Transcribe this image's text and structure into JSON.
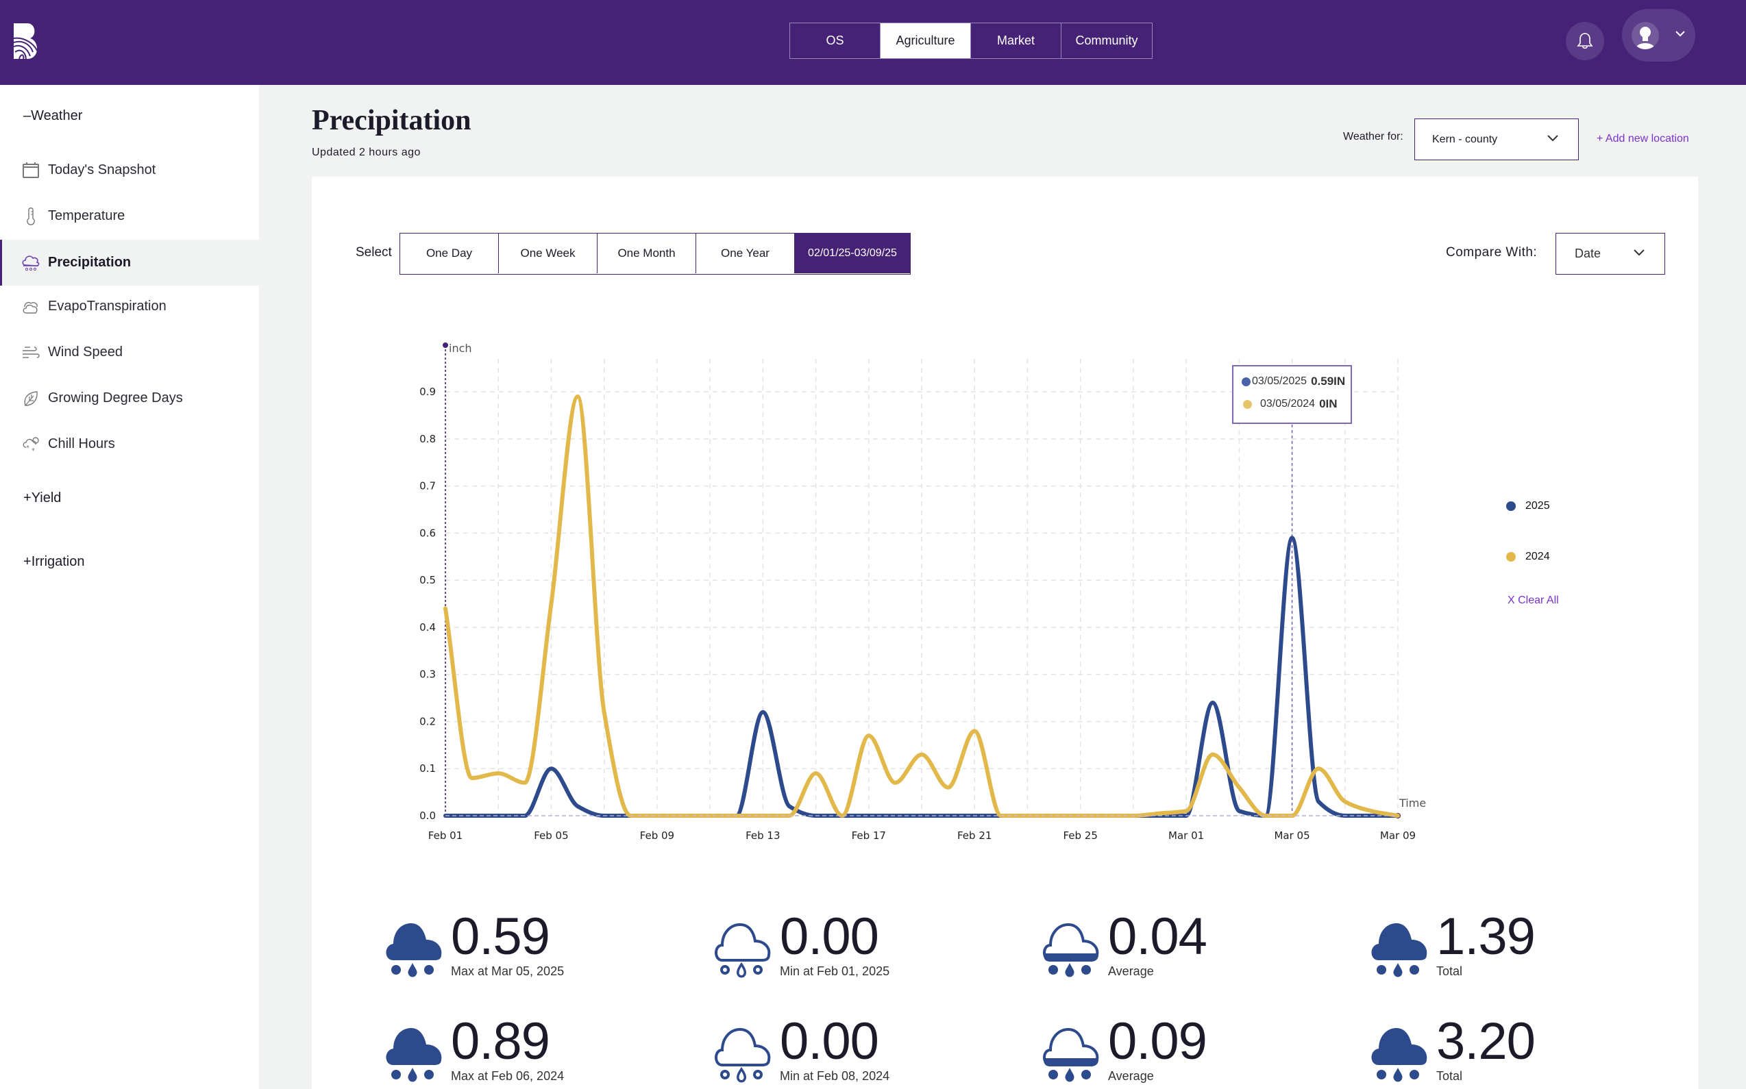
{
  "header": {
    "logo": "brand-logo",
    "nav_tabs": [
      {
        "label": "OS",
        "active": false
      },
      {
        "label": "Agriculture",
        "active": true
      },
      {
        "label": "Market",
        "active": false
      },
      {
        "label": "Community",
        "active": false
      }
    ],
    "icons": {
      "notifications": "bell-icon",
      "profile": "user-avatar-icon",
      "menu": "chevron-down-icon"
    }
  },
  "sidebar": {
    "weather_section": {
      "toggle": "–",
      "label": "Weather"
    },
    "items": [
      {
        "label": "Today's Snapshot",
        "icon": "calendar-icon",
        "active": false
      },
      {
        "label": "Temperature",
        "icon": "thermometer-icon",
        "active": false
      },
      {
        "label": "Precipitation",
        "icon": "rain-cloud-icon",
        "active": true
      },
      {
        "label": "EvapoTranspiration",
        "icon": "clouds-icon",
        "active": false
      },
      {
        "label": "Wind Speed",
        "icon": "wind-icon",
        "active": false
      },
      {
        "label": "Growing Degree Days",
        "icon": "leaf-icon",
        "active": false
      },
      {
        "label": "Chill Hours",
        "icon": "snow-cloud-icon",
        "active": false
      }
    ],
    "yield_section": {
      "toggle": "+",
      "label": "Yield"
    },
    "irrigation_section": {
      "toggle": "+",
      "label": "Irrigation"
    }
  },
  "page": {
    "title": "Precipitation",
    "updated": "Updated 2 hours ago",
    "weather_for_label": "Weather for:",
    "location_value": "Kern - county",
    "add_location": "+ Add new location"
  },
  "controls": {
    "select_label": "Select",
    "ranges": [
      {
        "label": "One Day",
        "active": false
      },
      {
        "label": "One Week",
        "active": false
      },
      {
        "label": "One Month",
        "active": false
      },
      {
        "label": "One Year",
        "active": false
      },
      {
        "label": "02/01/25-03/09/25",
        "active": true
      }
    ],
    "compare_label": "Compare With:",
    "compare_value": "Date"
  },
  "legend": {
    "items": [
      {
        "label": "2025",
        "color": "#2d4a8c"
      },
      {
        "label": "2024",
        "color": "#e2b84a"
      }
    ],
    "clear_all": "X Clear All"
  },
  "tooltip": {
    "rows": [
      {
        "date": "03/05/2025",
        "value": "0.59IN",
        "color": "#4a62a8"
      },
      {
        "date": "03/05/2024",
        "value": "0IN",
        "color": "#e6c56a"
      }
    ]
  },
  "chart_data": {
    "type": "line",
    "title": "",
    "xlabel": "Time",
    "ylabel": "inch",
    "ylim": [
      0,
      0.97
    ],
    "yticks": [
      "0.0",
      "0.1",
      "0.2",
      "0.3",
      "0.4",
      "0.5",
      "0.6",
      "0.7",
      "0.8",
      "0.9"
    ],
    "x": [
      "Feb 01",
      "Feb 02",
      "Feb 03",
      "Feb 04",
      "Feb 05",
      "Feb 06",
      "Feb 07",
      "Feb 08",
      "Feb 09",
      "Feb 10",
      "Feb 11",
      "Feb 12",
      "Feb 13",
      "Feb 14",
      "Feb 15",
      "Feb 16",
      "Feb 17",
      "Feb 18",
      "Feb 19",
      "Feb 20",
      "Feb 21",
      "Feb 22",
      "Feb 23",
      "Feb 24",
      "Feb 25",
      "Feb 26",
      "Feb 27",
      "Feb 28",
      "Mar 01",
      "Mar 02",
      "Mar 03",
      "Mar 04",
      "Mar 05",
      "Mar 06",
      "Mar 07",
      "Mar 08",
      "Mar 09"
    ],
    "xticks": [
      "Feb 01",
      "Feb 05",
      "Feb 09",
      "Feb 13",
      "Feb 17",
      "Feb 21",
      "Feb 25",
      "Mar 01",
      "Mar 05",
      "Mar 09"
    ],
    "grid": true,
    "legend_position": "right",
    "highlight": {
      "x": "Mar 05"
    },
    "series": [
      {
        "name": "2025",
        "color": "#2d4a8c",
        "values": [
          0,
          0,
          0,
          0,
          0.1,
          0.02,
          0,
          0,
          0,
          0,
          0,
          0,
          0.22,
          0.02,
          0,
          0,
          0,
          0,
          0,
          0,
          0,
          0,
          0,
          0,
          0,
          0,
          0,
          0,
          0,
          0.24,
          0.01,
          0,
          0.59,
          0.03,
          0,
          0,
          0
        ]
      },
      {
        "name": "2024",
        "color": "#e2b84a",
        "values": [
          0.44,
          0.08,
          0.09,
          0.07,
          0.45,
          0.89,
          0.22,
          0,
          0,
          0,
          0,
          0,
          0,
          0,
          0.09,
          0,
          0.17,
          0.07,
          0.13,
          0.06,
          0.18,
          0,
          0,
          0,
          0,
          0,
          0,
          0.005,
          0.01,
          0.13,
          0.06,
          0,
          0,
          0.1,
          0.03,
          0.01,
          0
        ]
      }
    ]
  },
  "stats": [
    {
      "value": "0.59",
      "label": "Max at Mar 05, 2025",
      "icon": "heavy-rain-icon"
    },
    {
      "value": "0.00",
      "label": "Min at Feb 01, 2025",
      "icon": "light-rain-icon"
    },
    {
      "value": "0.04",
      "label": "Average",
      "icon": "medium-rain-icon"
    },
    {
      "value": "1.39",
      "label": "Total",
      "icon": "heavy-rain-icon"
    },
    {
      "value": "0.89",
      "label": "Max at Feb 06, 2024",
      "icon": "heavy-rain-icon"
    },
    {
      "value": "0.00",
      "label": "Min at Feb 08, 2024",
      "icon": "light-rain-icon"
    },
    {
      "value": "0.09",
      "label": "Average",
      "icon": "medium-rain-icon"
    },
    {
      "value": "3.20",
      "label": "Total",
      "icon": "heavy-rain-icon"
    }
  ]
}
